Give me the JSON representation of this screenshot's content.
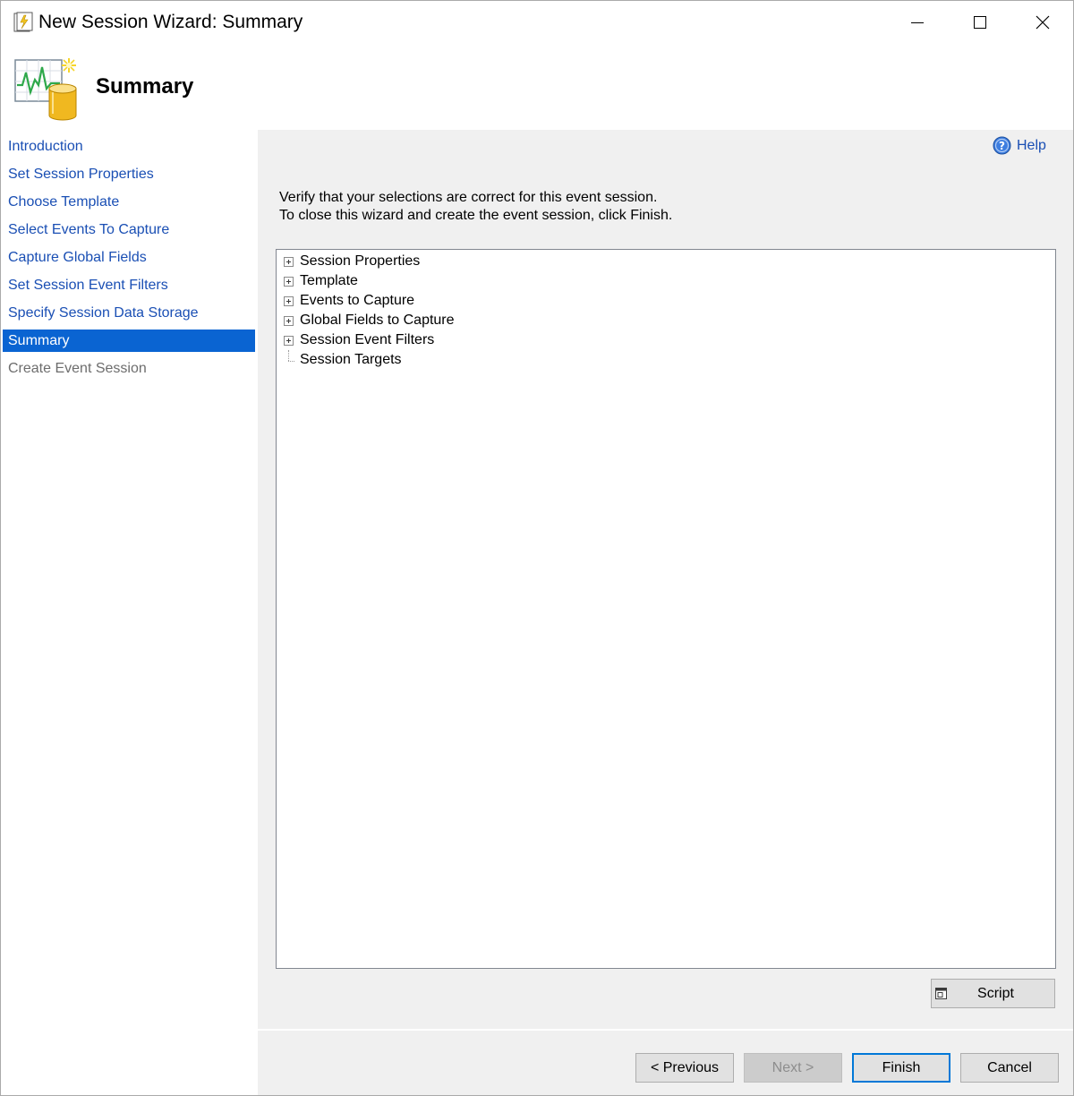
{
  "window": {
    "title": "New Session Wizard: Summary",
    "icons": {
      "app": "wizard-app-icon",
      "minimize": "minimize-icon",
      "maximize": "maximize-icon",
      "close": "close-icon"
    }
  },
  "header": {
    "title": "Summary",
    "icon": "event-session-chart-database-icon"
  },
  "nav": {
    "items": [
      {
        "label": "Introduction",
        "state": "link"
      },
      {
        "label": "Set Session Properties",
        "state": "link"
      },
      {
        "label": "Choose Template",
        "state": "link"
      },
      {
        "label": "Select Events To Capture",
        "state": "link"
      },
      {
        "label": "Capture Global Fields",
        "state": "link"
      },
      {
        "label": "Set Session Event Filters",
        "state": "link"
      },
      {
        "label": "Specify Session Data Storage",
        "state": "link"
      },
      {
        "label": "Summary",
        "state": "selected"
      },
      {
        "label": "Create Event Session",
        "state": "disabled"
      }
    ]
  },
  "main": {
    "help_label": "Help",
    "description_line1": "Verify that your selections are correct for this event session.",
    "description_line2": "To close this wizard and create the event session, click Finish.",
    "tree": [
      {
        "label": "Session Properties",
        "expandable": true
      },
      {
        "label": "Template",
        "expandable": true
      },
      {
        "label": "Events to Capture",
        "expandable": true
      },
      {
        "label": "Global Fields to Capture",
        "expandable": true
      },
      {
        "label": "Session Event Filters",
        "expandable": true
      },
      {
        "label": "Session Targets",
        "expandable": false
      }
    ],
    "script_label": "Script"
  },
  "footer": {
    "previous_label": "< Previous",
    "next_label": "Next >",
    "finish_label": "Finish",
    "cancel_label": "Cancel"
  },
  "colors": {
    "link": "#1a4fb4",
    "selected_bg": "#0a64d2",
    "panel_bg": "#f0f0f0",
    "default_button_border": "#0078d7"
  }
}
